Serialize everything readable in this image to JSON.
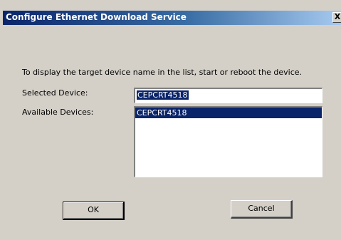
{
  "window": {
    "title": "Configure Ethernet Download Service",
    "close_glyph": "X"
  },
  "instruction": "To display the target device name in the list, start or reboot the device.",
  "selected_device": {
    "label": "Selected Device:",
    "value": "CEPCRT4518"
  },
  "available_devices": {
    "label": "Available Devices:",
    "items": [
      {
        "name": "CEPCRT4518",
        "selected": true
      }
    ]
  },
  "buttons": {
    "ok_label": "OK",
    "cancel_label": "Cancel"
  },
  "colors": {
    "titlebar_start": "#0a246a",
    "titlebar_end": "#a6caf0",
    "dialog_bg": "#d4d0c8",
    "selection": "#0a246a"
  }
}
